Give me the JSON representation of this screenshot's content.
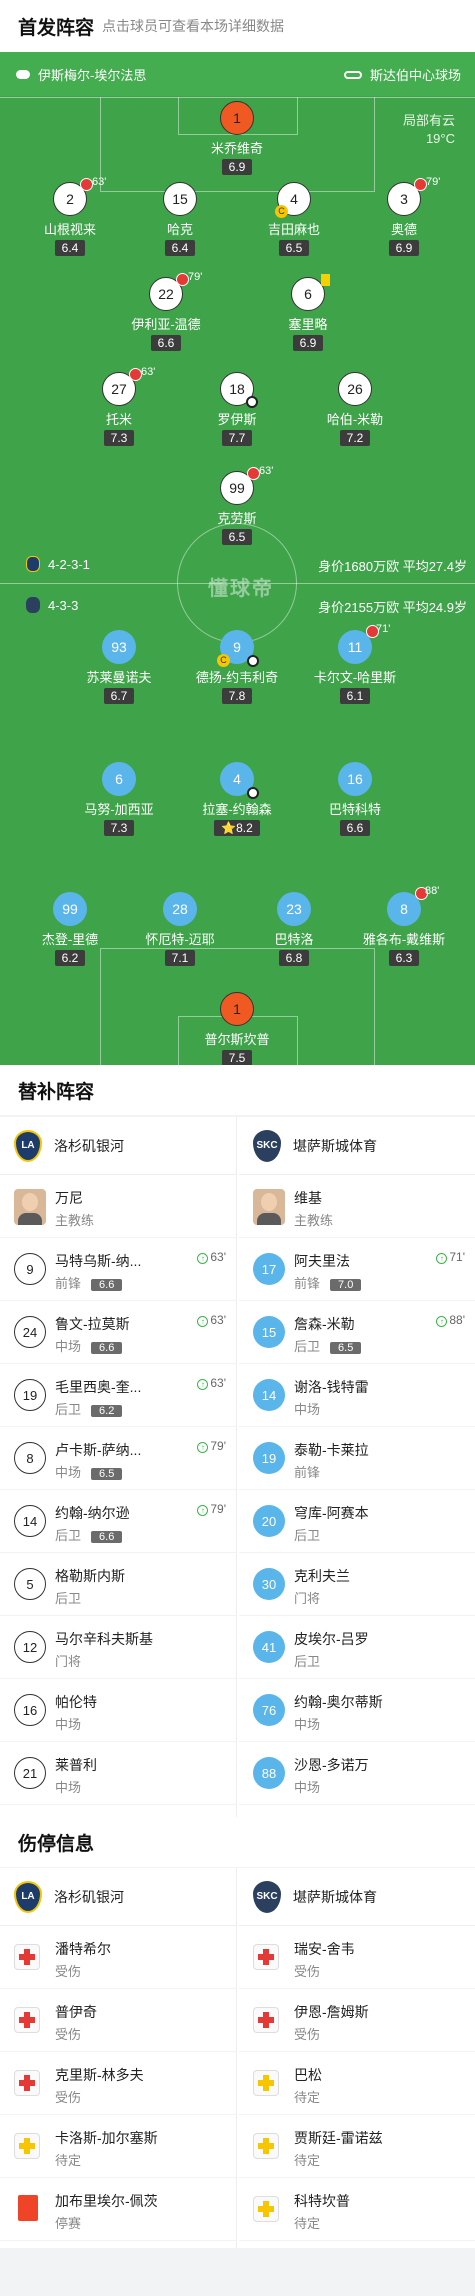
{
  "header": {
    "title": "首发阵容",
    "subtitle": "点击球员可查看本场详细数据"
  },
  "pitch": {
    "home_team": "伊斯梅尔-埃尔法思",
    "away_team": "斯达伯中心球场",
    "weather": "局部有云",
    "temp": "19°C",
    "home_formation": "4-2-3-1",
    "home_value": "身价1680万欧 平均27.4岁",
    "away_formation": "4-3-3",
    "away_value": "身价2155万欧 平均24.9岁",
    "watermark": "懂球帝",
    "home_players": [
      {
        "num": "1",
        "name": "米乔维奇",
        "rating": "6.9"
      },
      {
        "num": "2",
        "name": "山根视来",
        "rating": "6.4",
        "sub": "63'"
      },
      {
        "num": "15",
        "name": "哈克",
        "rating": "6.4"
      },
      {
        "num": "4",
        "name": "吉田麻也",
        "rating": "6.5"
      },
      {
        "num": "3",
        "name": "奥德",
        "rating": "6.9",
        "sub": "79'"
      },
      {
        "num": "22",
        "name": "伊利亚-温德",
        "rating": "6.6",
        "sub": "79'"
      },
      {
        "num": "6",
        "name": "塞里略",
        "rating": "6.9"
      },
      {
        "num": "27",
        "name": "托米",
        "rating": "7.3",
        "sub": "63'"
      },
      {
        "num": "18",
        "name": "罗伊斯",
        "rating": "7.7"
      },
      {
        "num": "26",
        "name": "哈伯-米勒",
        "rating": "7.2"
      },
      {
        "num": "99",
        "name": "克劳斯",
        "rating": "6.5",
        "sub": "63'"
      }
    ],
    "away_players": [
      {
        "num": "93",
        "name": "苏莱曼诺夫",
        "rating": "6.7"
      },
      {
        "num": "9",
        "name": "德扬-约韦利奇",
        "rating": "7.8"
      },
      {
        "num": "11",
        "name": "卡尔文-哈里斯",
        "rating": "6.1",
        "sub": "71'"
      },
      {
        "num": "6",
        "name": "马努-加西亚",
        "rating": "7.3"
      },
      {
        "num": "4",
        "name": "拉塞-约翰森",
        "rating": "8.2",
        "star": "⭐"
      },
      {
        "num": "16",
        "name": "巴特科特",
        "rating": "6.6"
      },
      {
        "num": "99",
        "name": "杰登-里德",
        "rating": "6.2"
      },
      {
        "num": "28",
        "name": "怀厄特-迈耶",
        "rating": "7.1"
      },
      {
        "num": "23",
        "name": "巴特洛",
        "rating": "6.8"
      },
      {
        "num": "8",
        "name": "雅各布-戴维斯",
        "rating": "6.3",
        "sub": "88'"
      },
      {
        "num": "1",
        "name": "普尔斯坎普",
        "rating": "7.5"
      }
    ]
  },
  "subs": {
    "title": "替补阵容",
    "home_team": "洛杉矶银河",
    "away_team": "堪萨斯城体育",
    "home": [
      {
        "num": "",
        "name": "万尼",
        "pos": "主教练"
      },
      {
        "num": "9",
        "name": "马特乌斯-纳...",
        "pos": "前锋",
        "rating": "6.6",
        "time": "63'"
      },
      {
        "num": "24",
        "name": "鲁文-拉莫斯",
        "pos": "中场",
        "rating": "6.6",
        "time": "63'"
      },
      {
        "num": "19",
        "name": "毛里西奥-奎...",
        "pos": "后卫",
        "rating": "6.2",
        "time": "63'"
      },
      {
        "num": "8",
        "name": "卢卡斯-萨纳...",
        "pos": "中场",
        "rating": "6.5",
        "time": "79'"
      },
      {
        "num": "14",
        "name": "约翰-纳尔逊",
        "pos": "后卫",
        "rating": "6.6",
        "time": "79'"
      },
      {
        "num": "5",
        "name": "格勒斯内斯",
        "pos": "后卫"
      },
      {
        "num": "12",
        "name": "马尔辛科夫斯基",
        "pos": "门将"
      },
      {
        "num": "16",
        "name": "帕伦特",
        "pos": "中场"
      },
      {
        "num": "21",
        "name": "莱普利",
        "pos": "中场"
      }
    ],
    "away": [
      {
        "num": "",
        "name": "维基",
        "pos": "主教练"
      },
      {
        "num": "17",
        "name": "阿夫里法",
        "pos": "前锋",
        "rating": "7.0",
        "time": "71'"
      },
      {
        "num": "15",
        "name": "詹森-米勒",
        "pos": "后卫",
        "rating": "6.5",
        "time": "88'"
      },
      {
        "num": "14",
        "name": "谢洛-钱特雷",
        "pos": "中场"
      },
      {
        "num": "19",
        "name": "泰勒-卡莱拉",
        "pos": "前锋"
      },
      {
        "num": "20",
        "name": "穹库-阿赛本",
        "pos": "后卫"
      },
      {
        "num": "30",
        "name": "克利夫兰",
        "pos": "门将"
      },
      {
        "num": "41",
        "name": "皮埃尔-吕罗",
        "pos": "后卫"
      },
      {
        "num": "76",
        "name": "约翰-奥尔蒂斯",
        "pos": "中场"
      },
      {
        "num": "88",
        "name": "沙恩-多诺万",
        "pos": "中场"
      }
    ]
  },
  "injuries": {
    "title": "伤停信息",
    "home_team": "洛杉矶银河",
    "away_team": "堪萨斯城体育",
    "home": [
      {
        "name": "潘特希尔",
        "status": "受伤",
        "kind": "injury"
      },
      {
        "name": "普伊奇",
        "status": "受伤",
        "kind": "injury"
      },
      {
        "name": "克里斯-林多夫",
        "status": "受伤",
        "kind": "injury"
      },
      {
        "name": "卡洛斯-加尔塞斯",
        "status": "待定",
        "kind": "doubt"
      },
      {
        "name": "加布里埃尔-佩茨",
        "status": "停赛",
        "kind": "red"
      }
    ],
    "away": [
      {
        "name": "瑞安-舍韦",
        "status": "受伤",
        "kind": "injury"
      },
      {
        "name": "伊恩-詹姆斯",
        "status": "受伤",
        "kind": "injury"
      },
      {
        "name": "巴松",
        "status": "待定",
        "kind": "doubt"
      },
      {
        "name": "贾斯廷-雷诺兹",
        "status": "待定",
        "kind": "doubt"
      },
      {
        "name": "科特坎普",
        "status": "待定",
        "kind": "doubt"
      }
    ]
  }
}
